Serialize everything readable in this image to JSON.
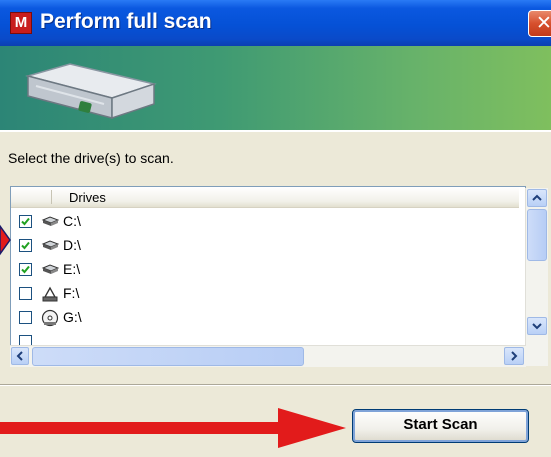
{
  "window": {
    "title": "Perform full scan",
    "app_icon_letter": "M",
    "close_glyph": "✕"
  },
  "instruction": "Select the drive(s) to scan.",
  "list": {
    "column_header": "Drives",
    "rows": [
      {
        "label": "C:\\",
        "checked": true,
        "icon": "hard-drive-icon"
      },
      {
        "label": "D:\\",
        "checked": true,
        "icon": "hard-drive-icon"
      },
      {
        "label": "E:\\",
        "checked": true,
        "icon": "hard-drive-icon"
      },
      {
        "label": "F:\\",
        "checked": false,
        "icon": "removable-drive-icon"
      },
      {
        "label": "G:\\",
        "checked": false,
        "icon": "cd-drive-icon"
      }
    ]
  },
  "buttons": {
    "start_scan": "Start Scan"
  },
  "colors": {
    "annotation_arrow": "#e21b1b",
    "titlebar": "#0551d6",
    "checkmark": "#21a121"
  }
}
